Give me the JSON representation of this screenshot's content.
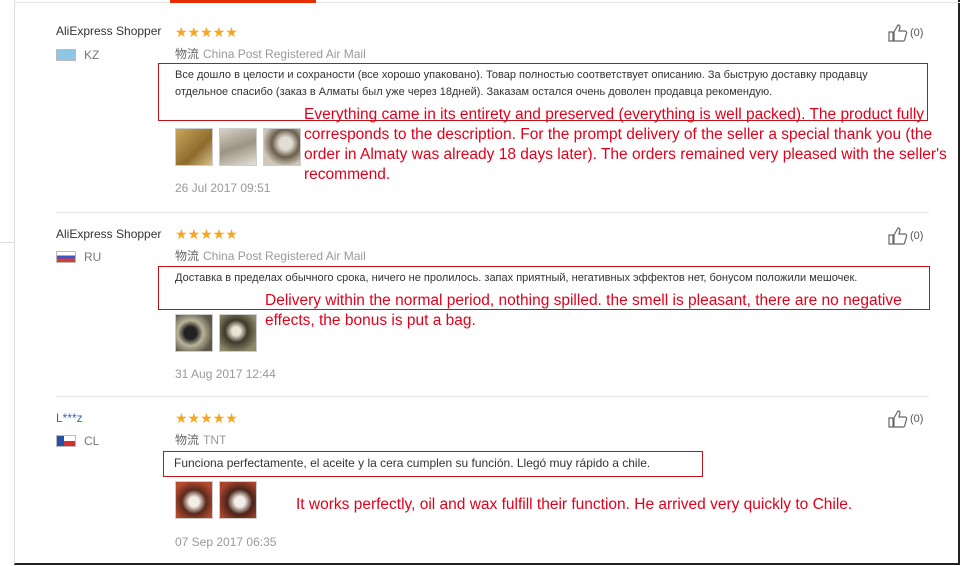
{
  "reviews": [
    {
      "user": "AliExpress Shopper",
      "country_code": "KZ",
      "rating": "★★★★★",
      "shipping_label": "物流",
      "shipping_method": "China Post Registered Air Mail",
      "feedback": "Все дошло в целости и сохраности (все хорошо упаковано). Товар полностью соответствует описанию. За быструю доставку продавцу отдельное спасибо (заказ в Алматы был уже через 18дней). Заказам остался очень доволен продавца рекомендую.",
      "translation": "Everything came in its entirety and preserved (everything is well packed). The product fully corresponds to the description. For the prompt delivery of the seller a special thank you (the order in Almaty was already 18 days later). The orders remained very pleased with the seller's recommend.",
      "date": "26 Jul 2017 09:51",
      "useful_count": "(0)"
    },
    {
      "user": "AliExpress Shopper",
      "country_code": "RU",
      "rating": "★★★★★",
      "shipping_label": "物流",
      "shipping_method": "China Post Registered Air Mail",
      "feedback": "Доставка в пределах обычного срока, ничего не пролилось. запах приятный, негативных эффектов нет, бонусом положили мешочек.",
      "translation": "Delivery within the normal period, nothing spilled. the smell is pleasant, there are no negative effects, the bonus is put a bag.",
      "date": "31 Aug 2017 12:44",
      "useful_count": "(0)"
    },
    {
      "user": "L***z",
      "country_code": "CL",
      "rating": "★★★★★",
      "shipping_label": "物流",
      "shipping_method": "TNT",
      "feedback": "Funciona perfectamente, el aceite y la cera cumplen su función. Llegó muy rápido a chile.",
      "translation": "It works perfectly, oil and wax fulfill their function. He arrived very quickly to Chile.",
      "date": "07 Sep 2017 06:35",
      "useful_count": "(0)"
    }
  ]
}
